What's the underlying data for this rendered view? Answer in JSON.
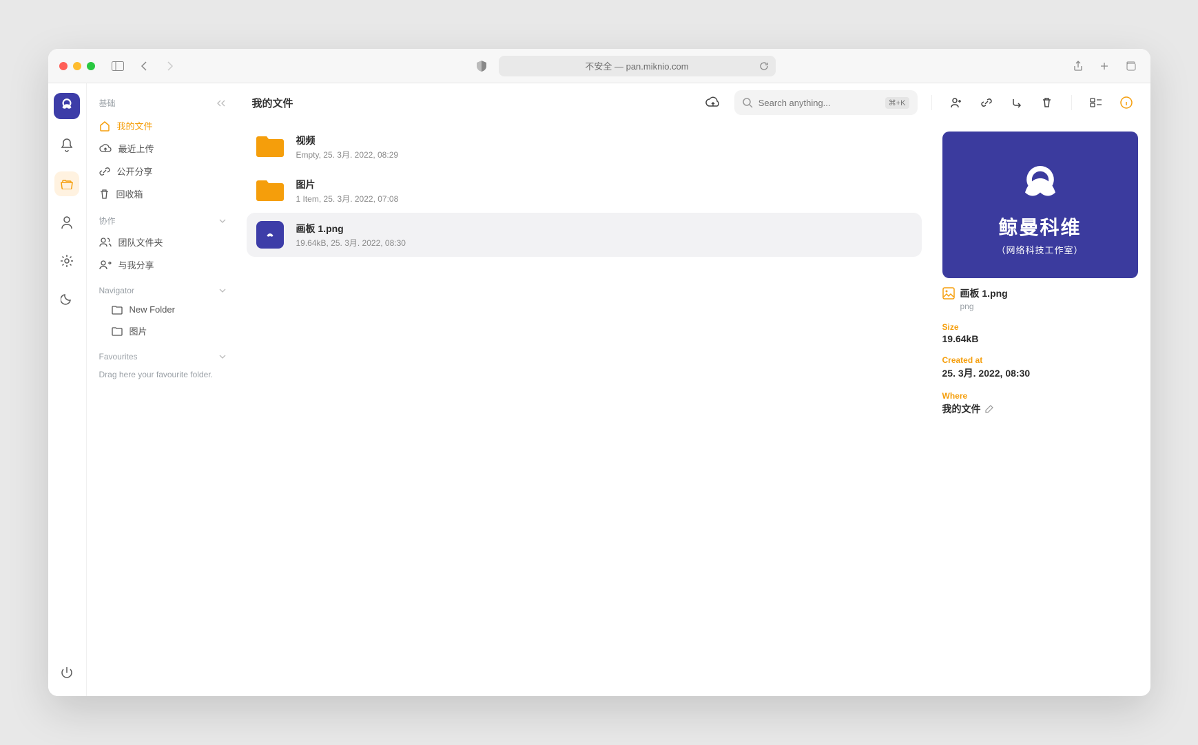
{
  "browser": {
    "url_text": "不安全 — pan.miknio.com"
  },
  "nav": {
    "sec_basic": "基础",
    "items_basic": {
      "my_files": "我的文件",
      "recent": "最近上传",
      "shared": "公开分享",
      "trash": "回收箱"
    },
    "sec_collab": "协作",
    "items_collab": {
      "team": "团队文件夹",
      "shared_with_me": "与我分享"
    },
    "sec_navigator": "Navigator",
    "tree": {
      "new_folder": "New Folder",
      "pictures": "图片"
    },
    "sec_fav": "Favourites",
    "fav_hint": "Drag here your favourite folder."
  },
  "header": {
    "title": "我的文件",
    "search_placeholder": "Search anything...",
    "search_kbd": "⌘+K"
  },
  "files": [
    {
      "name": "视频",
      "meta": "Empty, 25. 3月. 2022, 08:29",
      "type": "folder"
    },
    {
      "name": "图片",
      "meta": "1 Item, 25. 3月. 2022, 07:08",
      "type": "folder"
    },
    {
      "name": "画板 1.png",
      "meta": "19.64kB, 25. 3月. 2022, 08:30",
      "type": "image"
    }
  ],
  "details": {
    "preview_line1": "鲸曼科维",
    "preview_line2": "（网络科技工作室）",
    "filename": "画板 1.png",
    "ext": "png",
    "size_label": "Size",
    "size_value": "19.64kB",
    "created_label": "Created at",
    "created_value": "25. 3月. 2022, 08:30",
    "where_label": "Where",
    "where_value": "我的文件"
  }
}
